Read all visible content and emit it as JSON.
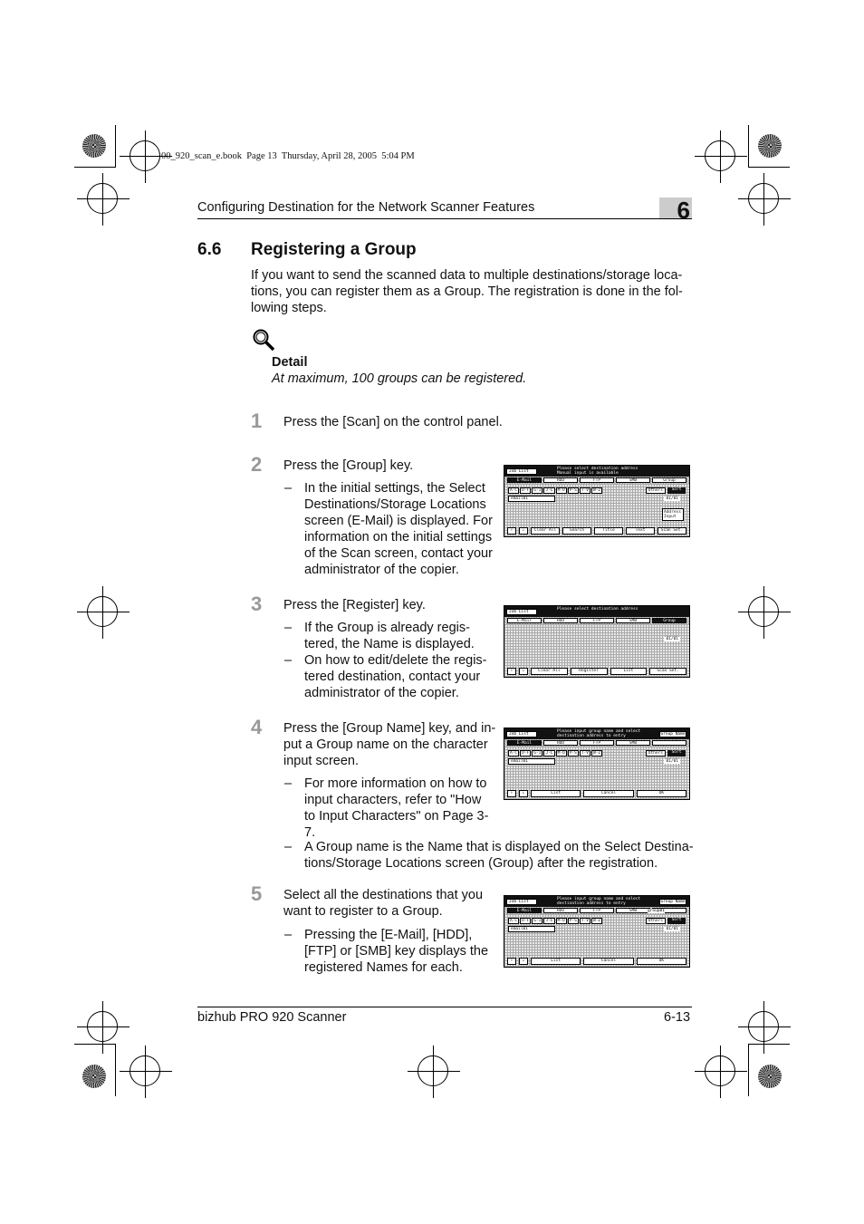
{
  "print_header": "00_920_scan_e.book  Page 13  Thursday, April 28, 2005  5:04 PM",
  "running_head": "Configuring Destination for the Network Scanner Features",
  "chapter": "6",
  "section": {
    "number": "6.6",
    "title": "Registering a Group"
  },
  "intro": [
    "If you want to send the scanned data to multiple destinations/storage loca-",
    "tions, you can register them as a Group. The registration is done in the fol-",
    "lowing steps."
  ],
  "detail": {
    "icon": "magnifier-icon",
    "label": "Detail",
    "text": "At maximum, 100 groups can be registered."
  },
  "steps": [
    {
      "n": "1",
      "lines": [
        "Press the [Scan] on the control panel."
      ]
    },
    {
      "n": "2",
      "lines": [
        "Press the [Group] key."
      ],
      "bullets": [
        [
          "In the initial settings, the Select",
          "Destinations/Storage Locations",
          "screen (E-Mail) is displayed. For",
          "information on the initial settings",
          "of the Scan screen, contact your",
          "administrator of the copier."
        ]
      ]
    },
    {
      "n": "3",
      "lines": [
        "Press the [Register] key."
      ],
      "bullets": [
        [
          "If the Group is already regis-",
          "tered, the Name is displayed."
        ],
        [
          "On how to edit/delete the regis-",
          "tered destination, contact your",
          "administrator of the copier."
        ]
      ]
    },
    {
      "n": "4",
      "lines": [
        "Press the [Group Name] key, and in-",
        "put a Group name on the character",
        "input screen."
      ],
      "bullets": [
        [
          "For more information on how to",
          "input characters, refer to \"How",
          "to Input Characters\" on Page 3-",
          "7."
        ],
        [
          "A Group name is the Name that is displayed on the Select Destina-",
          "tions/Storage Locations screen (Group) after the registration."
        ]
      ]
    },
    {
      "n": "5",
      "lines": [
        "Select all the destinations that you",
        "want to register to a Group."
      ],
      "bullets": [
        [
          "Pressing the [E-Mail], [HDD],",
          "[FTP] or [SMB] key displays the",
          "registered Names for each."
        ]
      ]
    }
  ],
  "screens": [
    {
      "job": "Job List",
      "msg": "Please select destination address\nManual input is available",
      "right": "",
      "tabs": [
        "E-Mail",
        "HDD",
        "FTP",
        "SMB",
        "Group"
      ],
      "active": 0,
      "keys": [
        "A-C",
        "D-F",
        "G-I",
        "J-L",
        "M-O",
        "P-S",
        "T-V",
        "W-Z"
      ],
      "field": "email01",
      "group": "",
      "others": "Others",
      "sort": "Sort",
      "page": "01/01",
      "address_input": "Address Input",
      "bottom": [
        "↑",
        "↓",
        "Clear All",
        "Search",
        "Title",
        "Text",
        "Scan Set."
      ]
    },
    {
      "job": "Job List",
      "msg": "Please select destination address",
      "right": "",
      "tabs": [
        "E-Mail",
        "HDD",
        "FTP",
        "SMB",
        "Group"
      ],
      "active": 4,
      "keys": [],
      "field": "",
      "group": "",
      "others": "",
      "sort": "",
      "page": "01/01",
      "address_input": "",
      "bottom": [
        "↑",
        "↓",
        "Clear All",
        "Register",
        "List",
        "Scan Set."
      ]
    },
    {
      "job": "Job List",
      "msg": "Please input group name and select\ndestination address to entry",
      "right": "Group Name",
      "tabs": [
        "E-Mail",
        "HDD",
        "FTP",
        "SMB",
        ""
      ],
      "active": 0,
      "keys": [
        "A-C",
        "D-F",
        "G-I",
        "J-L",
        "M-O",
        "P-S",
        "T-V",
        "W-Z"
      ],
      "field": "email01",
      "group": "",
      "others": "Others",
      "sort": "Sort",
      "page": "01/01",
      "address_input": "",
      "bottom": [
        "↑",
        "↓",
        "List",
        "Cancel",
        "OK"
      ]
    },
    {
      "job": "Job List",
      "msg": "Please input group name and select\ndestination address to entry",
      "right": "Group Name",
      "tabs": [
        "E-Mail",
        "HDD",
        "FTP",
        "SMB",
        ""
      ],
      "active": 0,
      "keys": [
        "A-C",
        "D-F",
        "G-I",
        "J-L",
        "M-O",
        "P-S",
        "T-V",
        "W-Z"
      ],
      "field": "email01",
      "group": "group01",
      "others": "Others",
      "sort": "Sort",
      "page": "01/01",
      "address_input": "",
      "bottom": [
        "↑",
        "↓",
        "List",
        "Cancel",
        "OK"
      ]
    }
  ],
  "footer": {
    "product": "bizhub PRO 920 Scanner",
    "page": "6-13"
  }
}
